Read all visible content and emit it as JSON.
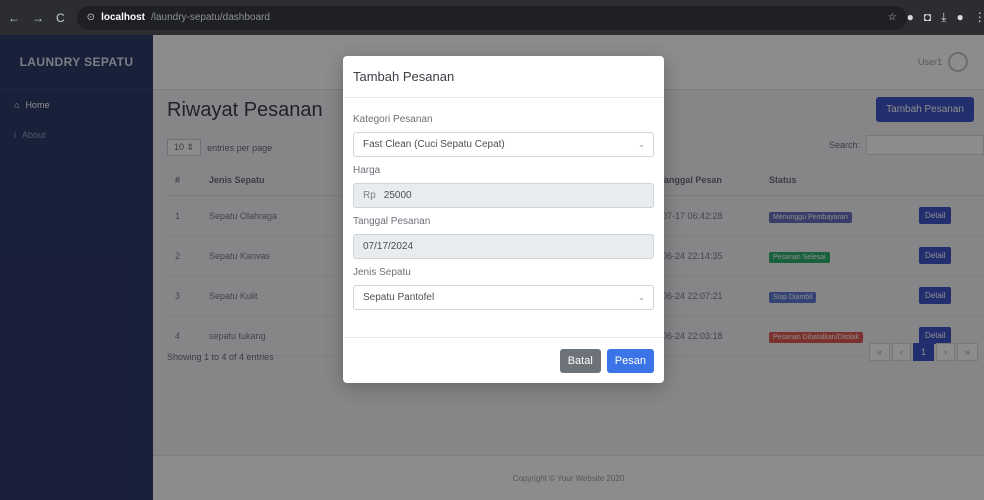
{
  "browser": {
    "host": "localhost",
    "path": "/laundry-sepatu/dashboard"
  },
  "sidebar": {
    "brand": "LAUNDRY SEPATU",
    "items": [
      {
        "label": "Home"
      },
      {
        "label": "About"
      }
    ]
  },
  "topbar": {
    "user": "User1"
  },
  "main": {
    "title": "Riwayat Pesanan",
    "add_button": "Tambah Pesanan",
    "entries_value": "10",
    "entries_text": "entries per page",
    "search_label": "Search:",
    "columns": [
      "#",
      "Jenis Sepatu",
      "Tanggal Pesan",
      "Status"
    ],
    "rows": [
      {
        "no": "1",
        "jenis": "Sepatu Olahraga",
        "tanggal": "-07-17 06:42:28",
        "status": "Menunggu Pembayaran",
        "color": "#6c6fbf"
      },
      {
        "no": "2",
        "jenis": "Sepatu Kanvas",
        "tanggal": "-06-24 22:14:35",
        "status": "Pesanan Selesai",
        "color": "#2fb070"
      },
      {
        "no": "3",
        "jenis": "Sepatu Kulit",
        "tanggal": "-06-24 22:07:21",
        "status": "Siap Diambil",
        "color": "#5d7bd6"
      },
      {
        "no": "4",
        "jenis": "sepatu tukang",
        "tanggal": "-06-24 22:03:18",
        "status": "Pesanan Dibatalkan/Ditolak",
        "color": "#e05a52"
      }
    ],
    "detail_label": "Detail",
    "showing": "Showing 1 to 4 of 4 entries",
    "pager_current": "1",
    "footer": "Copyright © Your Website 2020"
  },
  "modal": {
    "title": "Tambah Pesanan",
    "kategori_label": "Kategori Pesanan",
    "kategori_value": "Fast Clean (Cuci Sepatu Cepat)",
    "harga_label": "Harga",
    "harga_prefix": "Rp",
    "harga_value": "25000",
    "tanggal_label": "Tanggal Pesanan",
    "tanggal_value": "07/17/2024",
    "jenis_label": "Jenis Sepatu",
    "jenis_value": "Sepatu Pantofel",
    "batal_label": "Batal",
    "pesan_label": "Pesan"
  }
}
